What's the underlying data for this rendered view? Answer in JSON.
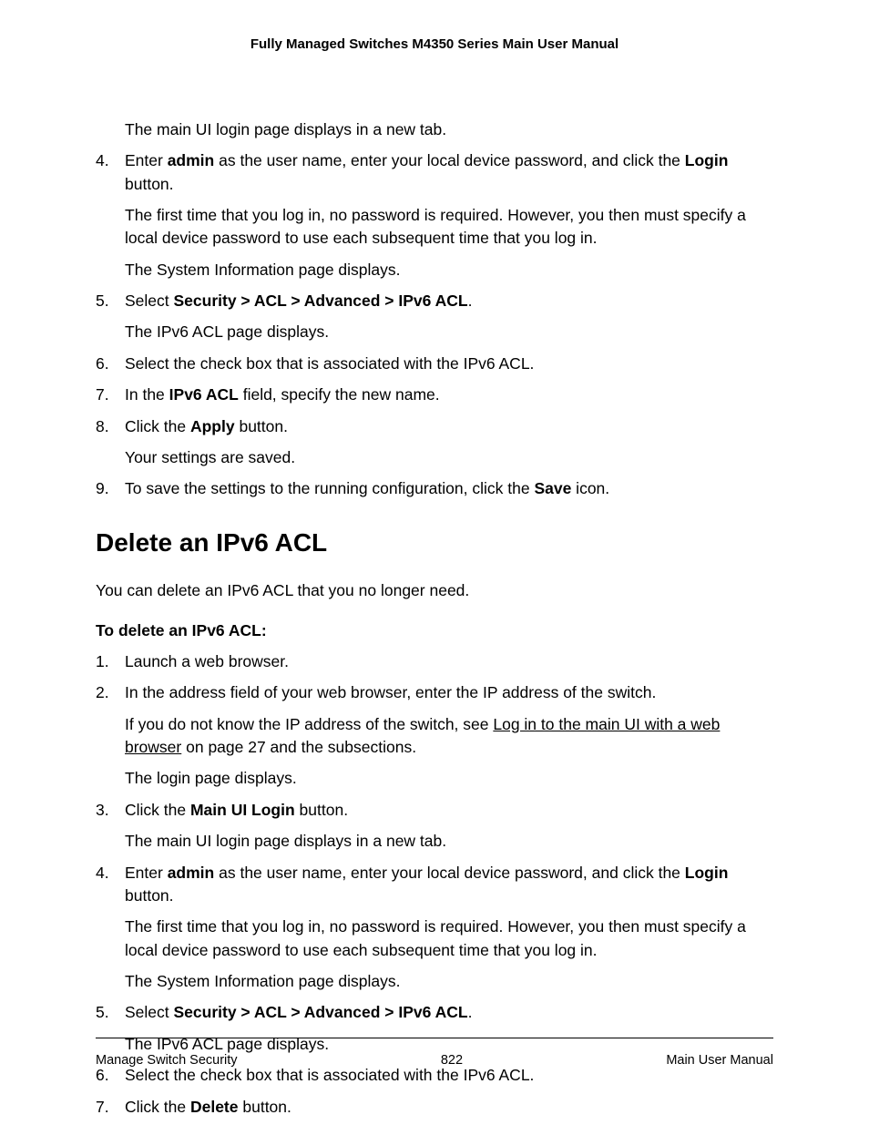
{
  "header": {
    "title": "Fully Managed Switches M4350 Series Main User Manual"
  },
  "top_steps": {
    "s3b": "The main UI login page displays in a new tab.",
    "s4_pre": "Enter ",
    "s4_b1": "admin",
    "s4_mid": " as the user name, enter your local device password, and click the ",
    "s4_b2": "Login",
    "s4_post": " button.",
    "s4_p2": "The first time that you log in, no password is required. However, you then must specify a local device password to use each subsequent time that you log in.",
    "s4_p3": "The System Information page displays.",
    "s5_pre": "Select ",
    "s5_b": "Security > ACL > Advanced > IPv6 ACL",
    "s5_post": ".",
    "s5_p2": "The IPv6 ACL page displays.",
    "s6": "Select the check box that is associated with the IPv6 ACL.",
    "s7_pre": "In the ",
    "s7_b": "IPv6 ACL",
    "s7_post": " field, specify the new name.",
    "s8_pre": "Click the ",
    "s8_b": "Apply",
    "s8_post": " button.",
    "s8_p2": "Your settings are saved.",
    "s9_pre": "To save the settings to the running configuration, click the ",
    "s9_b": "Save",
    "s9_post": " icon."
  },
  "section": {
    "heading": "Delete an IPv6 ACL",
    "intro": "You can delete an IPv6 ACL that you no longer need.",
    "do_heading": "To delete an IPv6 ACL:"
  },
  "steps2": {
    "s1": "Launch a web browser.",
    "s2": "In the address field of your web browser, enter the IP address of the switch.",
    "s2_p2_pre": "If you do not know the IP address of the switch, see ",
    "s2_p2_link": "Log in to the main UI with a web browser",
    "s2_p2_post": " on page 27 and the subsections.",
    "s2_p3": "The login page displays.",
    "s3_pre": "Click the ",
    "s3_b": "Main UI Login",
    "s3_post": " button.",
    "s3_p2": "The main UI login page displays in a new tab.",
    "s4_pre": "Enter ",
    "s4_b1": "admin",
    "s4_mid": " as the user name, enter your local device password, and click the ",
    "s4_b2": "Login",
    "s4_post": " button.",
    "s4_p2": "The first time that you log in, no password is required. However, you then must specify a local device password to use each subsequent time that you log in.",
    "s4_p3": "The System Information page displays.",
    "s5_pre": "Select ",
    "s5_b": "Security > ACL > Advanced > IPv6 ACL",
    "s5_post": ".",
    "s5_p2": "The IPv6 ACL page displays.",
    "s6": "Select the check box that is associated with the IPv6 ACL.",
    "s7_pre": "Click the ",
    "s7_b": "Delete",
    "s7_post": " button."
  },
  "footer": {
    "left": "Manage Switch Security",
    "center": "822",
    "right": "Main User Manual"
  }
}
